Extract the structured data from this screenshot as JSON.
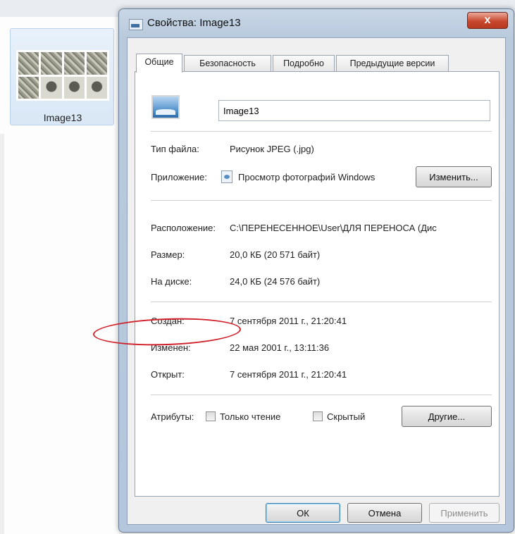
{
  "desktop": {
    "file_name": "Image13"
  },
  "dialog": {
    "title": "Свойства: Image13",
    "close_glyph": "x",
    "tabs": [
      {
        "label": "Общие"
      },
      {
        "label": "Безопасность"
      },
      {
        "label": "Подробно"
      },
      {
        "label": "Предыдущие версии"
      }
    ],
    "general": {
      "file_name_value": "Image13",
      "file_type": {
        "label": "Тип файла:",
        "value": "Рисунок JPEG (.jpg)"
      },
      "application": {
        "label": "Приложение:",
        "value": "Просмотр фотографий Windows",
        "change_label": "Изменить..."
      },
      "location": {
        "label": "Расположение:",
        "value": "C:\\ПЕРЕНЕСЕННОЕ\\User\\ДЛЯ ПЕРЕНОСА (Дис"
      },
      "size": {
        "label": "Размер:",
        "value": "20,0 КБ (20 571 байт)"
      },
      "size_on_disk": {
        "label": "На диске:",
        "value": "24,0 КБ (24 576 байт)"
      },
      "created": {
        "label": "Создан:",
        "value": "7 сентября 2011 г., 21:20:41"
      },
      "modified": {
        "label": "Изменен:",
        "value": "22 мая 2001 г., 13:11:36"
      },
      "accessed": {
        "label": "Открыт:",
        "value": "7 сентября 2011 г., 21:20:41"
      },
      "attributes": {
        "label": "Атрибуты:",
        "readonly_label": "Только чтение",
        "hidden_label": "Скрытый",
        "other_label": "Другие..."
      }
    },
    "buttons": {
      "ok": "ОК",
      "cancel": "Отмена",
      "apply": "Применить"
    },
    "annotation_color": "#d0202a"
  }
}
